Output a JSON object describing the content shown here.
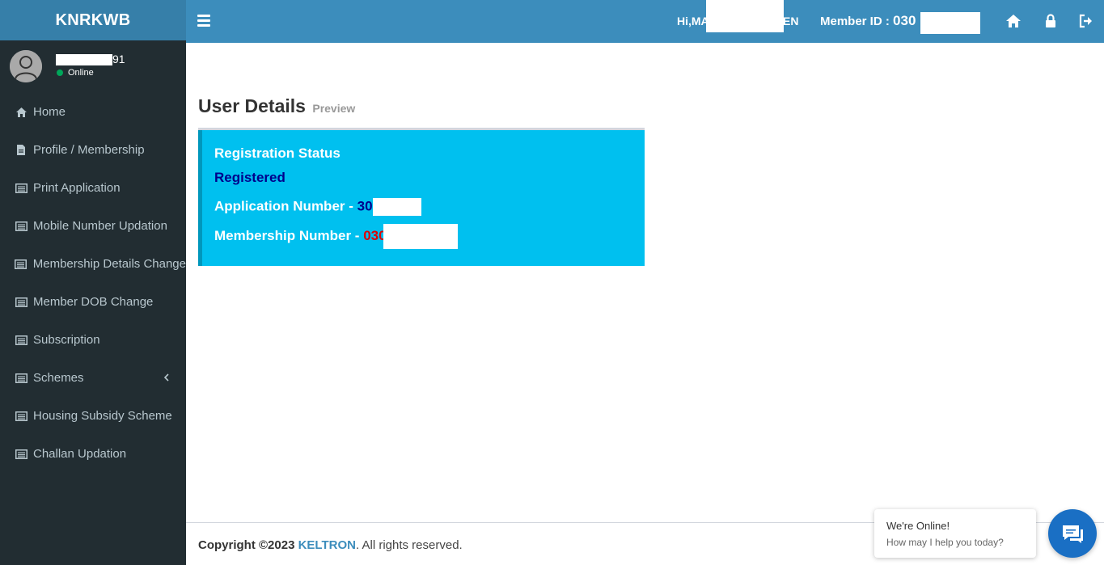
{
  "sidebar": {
    "brand": "KNRKWB",
    "user": {
      "name_suffix": "91",
      "status": "Online"
    },
    "items": [
      {
        "label": "Home",
        "icon": "home-icon"
      },
      {
        "label": "Profile / Membership",
        "icon": "file-icon"
      },
      {
        "label": "Print Application",
        "icon": "list-icon"
      },
      {
        "label": "Mobile Number Updation",
        "icon": "list-icon"
      },
      {
        "label": "Membership Details Change",
        "icon": "list-icon"
      },
      {
        "label": "Member DOB Change",
        "icon": "list-icon"
      },
      {
        "label": "Subscription",
        "icon": "list-icon"
      },
      {
        "label": "Schemes",
        "icon": "list-icon"
      },
      {
        "label": "Housing Subsidy Scheme",
        "icon": "list-icon"
      },
      {
        "label": "Challan Updation",
        "icon": "list-icon"
      }
    ]
  },
  "header": {
    "greeting_prefix": "Hi,MA",
    "greeting_suffix": "EN",
    "member_id_label": "Member ID :",
    "member_id_value": "030",
    "colors": {
      "topbar": "#3c8dbc",
      "brand_bar": "#367fa9"
    }
  },
  "main": {
    "title": "User Details",
    "subtitle": "Preview",
    "registration": {
      "heading": "Registration Status",
      "status": "Registered",
      "application_label": "Application Number - ",
      "application_value": "30",
      "membership_label": "Membership Number - ",
      "membership_value": "030"
    }
  },
  "footer": {
    "copyright": "Copyright ©2023",
    "company": "KELTRON",
    "rights": ". All rights reserved."
  },
  "chat": {
    "title": "We're Online!",
    "subtitle": "How may I help you today?"
  }
}
